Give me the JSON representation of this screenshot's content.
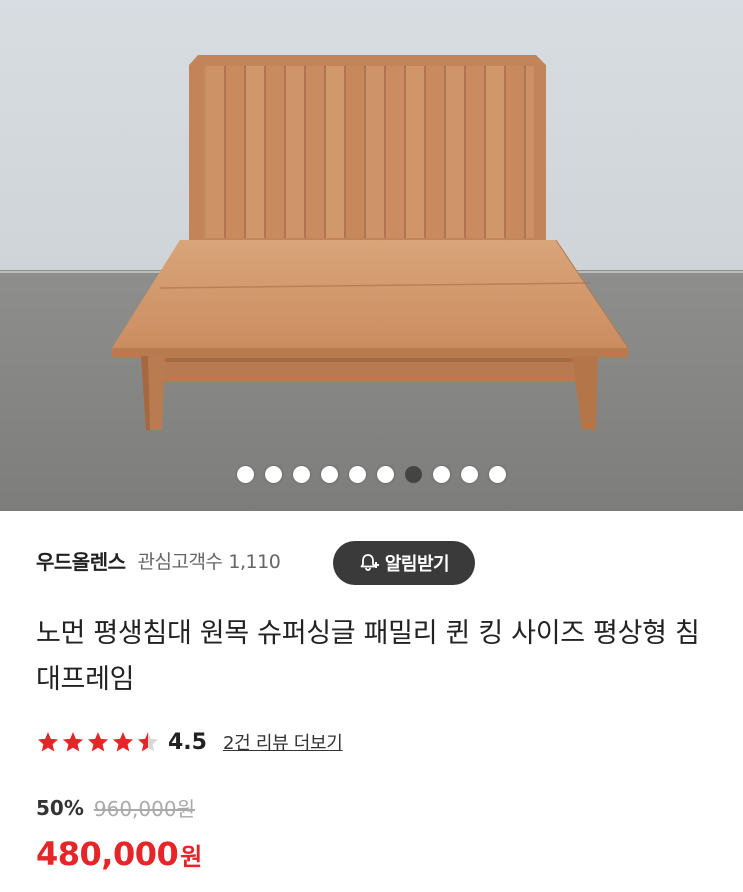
{
  "product_image": {
    "description_icon": "bed-frame-image",
    "carousel": {
      "total": 10,
      "active_index": 6
    }
  },
  "seller": {
    "name": "우드올렌스",
    "fans_label": "관심고객수",
    "fans_count": "1,110",
    "alarm_button_label": "알림받기"
  },
  "product": {
    "title": "노먼 평생침대 원목 슈퍼싱글 패밀리 퀸 킹 사이즈 평상형 침대프레임",
    "rating": {
      "value": "4.5",
      "stars_filled": 4.5,
      "stars_total": 5,
      "review_link": "2건 리뷰 더보기"
    },
    "discount_rate": "50%",
    "original_price": "960,000원",
    "price": "480,000",
    "currency": "원"
  },
  "colors": {
    "star": "#e52528",
    "price": "#e52528",
    "button_bg": "#3a3a3a"
  }
}
